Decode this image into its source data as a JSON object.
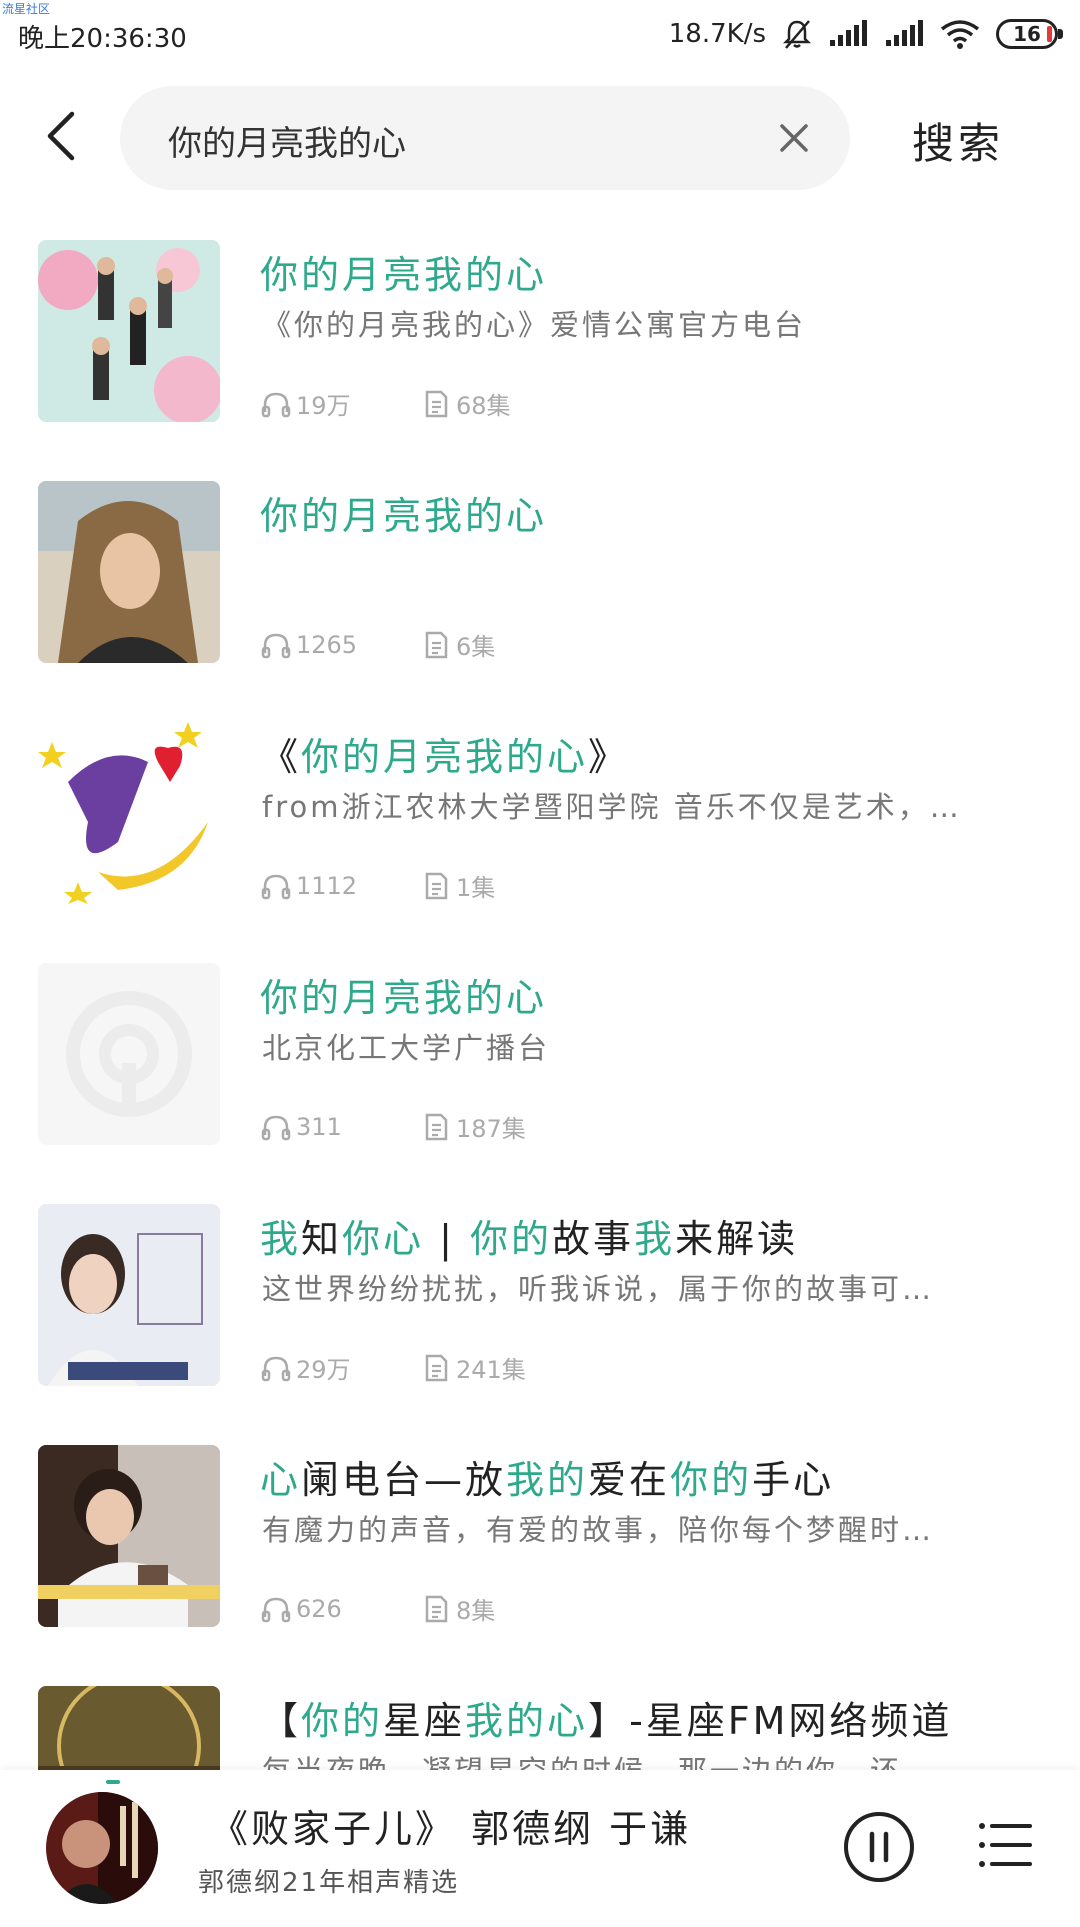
{
  "watermark": "流星社区",
  "status_bar": {
    "time": "晚上20:36:30",
    "net_speed": "18.7K/s",
    "battery_level": "16",
    "icons": [
      "mute-bell-icon",
      "signal-icon",
      "signal-icon",
      "wifi-icon",
      "battery-icon"
    ]
  },
  "search": {
    "query": "你的月亮我的心",
    "search_label": "搜索"
  },
  "colors": {
    "highlight": "#2fa98c",
    "subtitle": "#777777",
    "meta": "#aaaaaa"
  },
  "results": [
    {
      "title": [
        {
          "t": "你的月亮我的心",
          "hl": true
        }
      ],
      "subtitle": "《你的月亮我的心》爱情公寓官方电台",
      "plays": "19万",
      "episodes": "68集"
    },
    {
      "title": [
        {
          "t": "你的月亮我的心",
          "hl": true
        }
      ],
      "subtitle": "",
      "plays": "1265",
      "episodes": "6集"
    },
    {
      "title": [
        {
          "t": "《",
          "hl": false
        },
        {
          "t": "你的月亮我的心",
          "hl": true
        },
        {
          "t": "》",
          "hl": false
        }
      ],
      "subtitle": "from浙江农林大学暨阳学院 音乐不仅是艺术，…",
      "plays": "1112",
      "episodes": "1集"
    },
    {
      "title": [
        {
          "t": "你的月亮我的心",
          "hl": true
        }
      ],
      "subtitle": "北京化工大学广播台",
      "plays": "311",
      "episodes": "187集"
    },
    {
      "title": [
        {
          "t": "我",
          "hl": true
        },
        {
          "t": "知",
          "hl": false
        },
        {
          "t": "你",
          "hl": true
        },
        {
          "t": "心",
          "hl": true
        },
        {
          "t": " | ",
          "hl": false
        },
        {
          "t": "你的",
          "hl": true
        },
        {
          "t": "故事",
          "hl": false
        },
        {
          "t": "我",
          "hl": true
        },
        {
          "t": "来解读",
          "hl": false
        }
      ],
      "subtitle": "这世界纷纷扰扰，听我诉说，属于你的故事可…",
      "plays": "29万",
      "episodes": "241集"
    },
    {
      "title": [
        {
          "t": "心",
          "hl": true
        },
        {
          "t": "阑电台—放",
          "hl": false
        },
        {
          "t": "我的",
          "hl": true
        },
        {
          "t": "爱在",
          "hl": false
        },
        {
          "t": "你的",
          "hl": true
        },
        {
          "t": "手心",
          "hl": false
        }
      ],
      "subtitle": "有魔力的声音，有爱的故事，陪你每个梦醒时…",
      "plays": "626",
      "episodes": "8集"
    },
    {
      "title": [
        {
          "t": "【",
          "hl": false
        },
        {
          "t": "你的",
          "hl": true
        },
        {
          "t": "星座",
          "hl": false
        },
        {
          "t": "我的心",
          "hl": true
        },
        {
          "t": "】-星座FM网络频道",
          "hl": false
        }
      ],
      "subtitle": "每当夜晚，凝望星空的时候，那一边的你，还…",
      "plays": "",
      "episodes": ""
    }
  ],
  "player": {
    "title": "《败家子儿》 郭德纲 于谦",
    "subtitle": "郭德纲21年相声精选"
  }
}
